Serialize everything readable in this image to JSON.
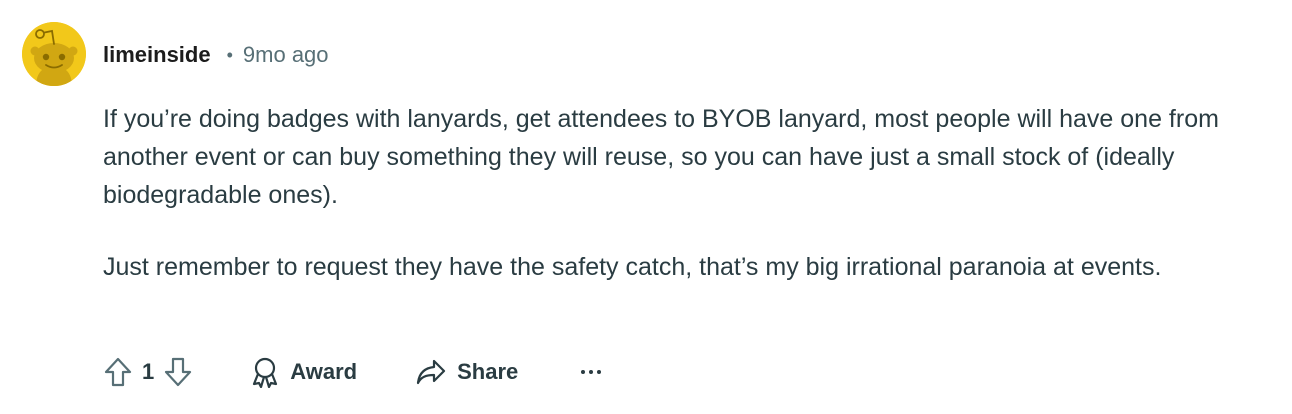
{
  "comment": {
    "author": "limeinside",
    "separator": "•",
    "timestamp": "9mo ago",
    "avatar_icon": "reddit-snoo-avatar-icon",
    "avatar_color": "#f2c81a",
    "paragraphs": [
      "If you’re doing badges with lanyards, get attendees to BYOB lanyard, most people will have one from another event or can buy something they will reuse, so you can have just a small stock of (ideally biodegradable ones).",
      "Just remember to request they have the safety catch, that’s my big irrational paranoia at events."
    ]
  },
  "actions": {
    "upvote_icon": "upvote-arrow-icon",
    "score": "1",
    "downvote_icon": "downvote-arrow-icon",
    "award_icon": "award-ribbon-icon",
    "award_label": "Award",
    "share_icon": "share-arrow-icon",
    "share_label": "Share",
    "more_icon": "more-options-icon",
    "more_label": "···"
  },
  "colors": {
    "text": "#2a3c42",
    "muted": "#576f76",
    "author": "#1c1c1c"
  }
}
